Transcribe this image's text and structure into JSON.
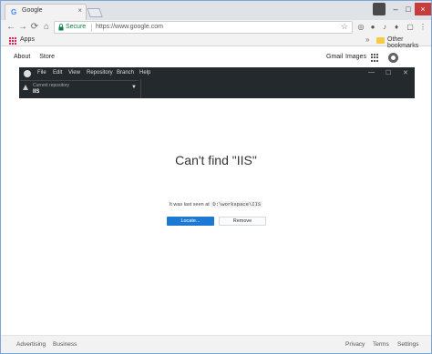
{
  "browser": {
    "tab_title": "Google",
    "tab_favicon": "G",
    "tab_close": "×",
    "window_controls": {
      "minimize": "–",
      "maximize": "□",
      "close": "×"
    },
    "nav": {
      "back": "←",
      "forward": "→",
      "reload": "⟳",
      "home": "⌂"
    },
    "omnibox": {
      "secure_label": "Secure",
      "url": "https://www.google.com"
    },
    "extension_icons": [
      "extension-icon-1",
      "extension-icon-2",
      "extension-icon-3",
      "extension-icon-4",
      "extension-icon-5"
    ],
    "bookmarks": {
      "apps_label": "Apps",
      "chevron": "»",
      "other_label": "Other bookmarks"
    }
  },
  "google": {
    "top_left": [
      "About",
      "Store"
    ],
    "top_right": [
      "Gmail",
      "Images"
    ],
    "footer_left": [
      "Advertising",
      "Business"
    ],
    "footer_right": [
      "Privacy",
      "Terms",
      "Settings"
    ]
  },
  "github_desktop": {
    "menu": [
      "File",
      "Edit",
      "View",
      "Repository",
      "Branch",
      "Help"
    ],
    "window_controls": {
      "minimize": "—",
      "maximize": "☐",
      "close": "✕"
    },
    "repo_caption": "Current repository",
    "repo_name": "IIS",
    "repo_caret": "▼"
  },
  "content": {
    "headline": "Can't find \"IIS\"",
    "subline_prefix": "It was last seen at",
    "path": "D:\\workspace\\IIS",
    "locate_button": "Locate...",
    "remove_button": "Remove"
  },
  "colors": {
    "primary_button": "#1b79d4",
    "app_bar": "#24292e",
    "secure_green": "#0b8043"
  }
}
